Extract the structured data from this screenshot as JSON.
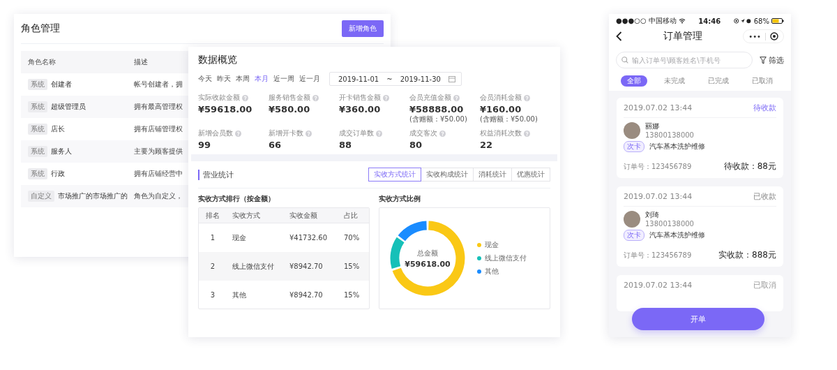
{
  "role_window": {
    "title": "角色管理",
    "add_button": "新增角色",
    "columns": [
      "角色名称",
      "描述"
    ],
    "rows": [
      {
        "tag": "系统",
        "name": "创建者",
        "description": "帐号创建者，拥"
      },
      {
        "tag": "系统",
        "name": "超级管理员",
        "description": "拥有最高管理权"
      },
      {
        "tag": "系统",
        "name": "店长",
        "description": "拥有店铺管理权"
      },
      {
        "tag": "系统",
        "name": "服务人",
        "description": "主要为顾客提供"
      },
      {
        "tag": "系统",
        "name": "行政",
        "description": "拥有店铺经营中"
      },
      {
        "tag": "自定义",
        "name": "市场推广的市场推广的",
        "description": "角色为自定义，"
      }
    ]
  },
  "overview_window": {
    "title": "数据概览",
    "quick_ranges": [
      {
        "label": "今天",
        "selected": false
      },
      {
        "label": "昨天",
        "selected": false
      },
      {
        "label": "本周",
        "selected": false
      },
      {
        "label": "本月",
        "selected": true
      },
      {
        "label": "近一周",
        "selected": false
      },
      {
        "label": "近一月",
        "selected": false
      }
    ],
    "date_range": {
      "start": "2019-11-01",
      "separator": "~",
      "end": "2019-11-30"
    },
    "stats": [
      {
        "label": "实际收款金额",
        "value": "¥59618.00"
      },
      {
        "label": "服务销售金额",
        "value": "¥580.00"
      },
      {
        "label": "开卡销售金额",
        "value": "¥360.00"
      },
      {
        "label": "会员充值金额",
        "value": "¥58888.00",
        "note": "(含赠额：¥50.00)"
      },
      {
        "label": "会员消耗金额",
        "value": "¥160.00",
        "note": "(含赠额：¥50.00)"
      },
      {
        "label": "新增会员数",
        "value": "99"
      },
      {
        "label": "新增开卡数",
        "value": "66"
      },
      {
        "label": "成交订单数",
        "value": "88"
      },
      {
        "label": "成交客次",
        "value": "80"
      },
      {
        "label": "权益消耗次数",
        "value": "22"
      }
    ],
    "section_title": "营业统计",
    "tabs": [
      {
        "label": "实收方式统计",
        "selected": true
      },
      {
        "label": "实收构成统计",
        "selected": false
      },
      {
        "label": "消耗统计",
        "selected": false
      },
      {
        "label": "优惠统计",
        "selected": false
      }
    ],
    "ranking": {
      "title": "实收方式排行（按金额）",
      "columns": [
        "排名",
        "实收方式",
        "实收金额",
        "占比"
      ],
      "rows": [
        [
          "1",
          "现金",
          "¥41732.60",
          "70%"
        ],
        [
          "2",
          "线上微信支付",
          "¥8942.70",
          "15%"
        ],
        [
          "3",
          "其他",
          "¥8942.70",
          "15%"
        ]
      ]
    },
    "ratio": {
      "center_label": "总金额",
      "center_value": "¥59618.00",
      "legend": [
        {
          "color": "#fac815"
        },
        {
          "color": "#16c0b8"
        },
        {
          "color": "#1a8cff"
        }
      ],
      "chart_data": {
        "type": "donut",
        "title": "实收方式比例",
        "categories": [
          "现金",
          "线上微信支付",
          "其他"
        ],
        "values": [
          70,
          15,
          15
        ],
        "legend": "right"
      }
    }
  },
  "phone": {
    "status_bar": {
      "carrier": "●●●○○ 中国移动",
      "time": "14:46",
      "battery": "68%"
    },
    "title": "订单管理",
    "capsule_dots": "•••",
    "search": {
      "placeholder": "输入订单号\\顾客姓名\\手机号"
    },
    "filter": "筛选",
    "tabs": [
      {
        "label": "全部",
        "selected": true
      },
      {
        "label": "未完成",
        "selected": false
      },
      {
        "label": "已完成",
        "selected": false
      },
      {
        "label": "已取消",
        "selected": false
      }
    ],
    "orders": [
      {
        "time": "2019.07.02 13:44",
        "status": "待收款",
        "kind": "pending",
        "name": "丽娜",
        "phone": "13800138000",
        "tag": "次卡",
        "service": "汽车基本洗护维修",
        "order_no": "订单号：123456789",
        "amount": "待收款：88元"
      },
      {
        "time": "2019.07.02 13:44",
        "status": "已收款",
        "kind": "paid",
        "name": "刘琦",
        "phone": "13800138000",
        "tag": "次卡",
        "service": "汽车基本洗护维修",
        "order_no": "订单号：123456789",
        "amount": "实收款：888元"
      },
      {
        "time": "2019.07.02 13:44",
        "status": "已取消",
        "kind": "cancelled"
      }
    ],
    "open_button": "开单"
  }
}
